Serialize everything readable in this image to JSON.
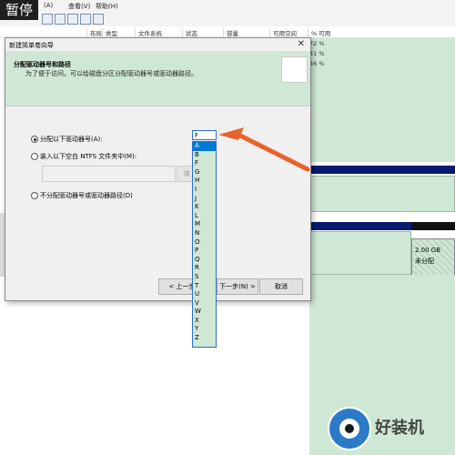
{
  "pause_label": "暂停",
  "menu": [
    {
      "label": "(A)"
    },
    {
      "label": "查看(V)"
    },
    {
      "label": "帮助(H)"
    }
  ],
  "volume_columns": [
    "布局",
    "类型",
    "文件系统",
    "状态",
    "容量",
    "可用空间",
    "% 可用"
  ],
  "volume_pct": [
    "72 %",
    "41 %",
    "46 %"
  ],
  "unallocated": {
    "size": "2.00 GB",
    "label": "未分配"
  },
  "dialog": {
    "title": "新建简单卷向导",
    "heading": "分配驱动器号和路径",
    "subtitle": "为了便于访问，可以给磁盘分区分配驱动器号或驱动器路径。",
    "option_assign": "分配以下驱动器号(A):",
    "option_mount": "装入以下空白 NTFS 文件夹中(M):",
    "option_none": "不分配驱动器号或驱动器路径(D)",
    "browse": "浏",
    "back_button": "< 上一步(B)",
    "next_button": "下一步(N) >",
    "cancel_button": "取消"
  },
  "drive_dropdown": {
    "value": "F",
    "options": [
      "A",
      "B",
      "F",
      "G",
      "H",
      "I",
      "J",
      "K",
      "L",
      "M",
      "N",
      "O",
      "P",
      "Q",
      "R",
      "S",
      "T",
      "U",
      "V",
      "W",
      "X",
      "Y",
      "Z"
    ],
    "selected": "A"
  },
  "watermark": "好装机",
  "colors": {
    "accent": "#0078d7",
    "arrow": "#e8622a",
    "panel_green": "#cfe8d5",
    "bar_navy": "#061a6e"
  }
}
